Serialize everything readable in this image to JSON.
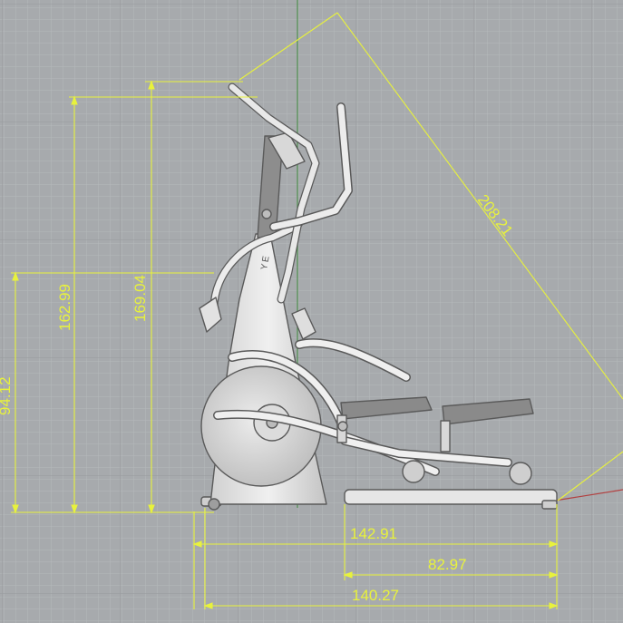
{
  "viewport": {
    "background": "#a7aaad",
    "grid_minor_color": "#b6b9bc",
    "grid_major_color": "#9a9da0",
    "axis_green": "#4f8f4f",
    "axis_red": "#b24040"
  },
  "dimension_color": "#e8f23c",
  "model_colors": {
    "body": "#e4e4e4",
    "shade": "#c9c9c9",
    "outline": "#5a5a5a",
    "flywheel": "#d6d6d6"
  },
  "brand_mark": "YE",
  "dimensions": {
    "height_front": "94.12",
    "height_console": "162.99",
    "height_handle": "169.04",
    "diagonal": "208.21",
    "length_total": "142.91",
    "length_rail": "82.97",
    "length_base": "140.27"
  }
}
